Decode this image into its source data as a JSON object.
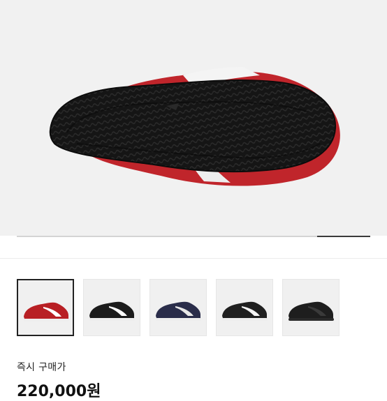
{
  "gallery": {
    "current_index": 1,
    "progress_fraction": 0.15
  },
  "thumbnails": [
    {
      "name": "red",
      "upper": "#b81f24",
      "stripe": "#ffffff",
      "sole": "#eeeeee",
      "selected": true
    },
    {
      "name": "black",
      "upper": "#1c1c1c",
      "stripe": "#ffffff",
      "sole": "#eeeeee",
      "selected": false
    },
    {
      "name": "navy",
      "upper": "#2a2d4a",
      "stripe": "#e8e8e8",
      "sole": "#eeeeee",
      "selected": false
    },
    {
      "name": "black-gold",
      "upper": "#202020",
      "stripe": "#f4f4f4",
      "sole": "#eeeeee",
      "selected": false
    },
    {
      "name": "all-black",
      "upper": "#1e1e1e",
      "stripe": "#3a3a3a",
      "sole": "#2a2a2a",
      "selected": false
    }
  ],
  "purchase": {
    "label": "즉시 구매가",
    "price": "220,000원"
  },
  "colors": {
    "hero_bg": "#f1f1f1",
    "sole_black": "#141414",
    "upper_red": "#c0252b"
  }
}
